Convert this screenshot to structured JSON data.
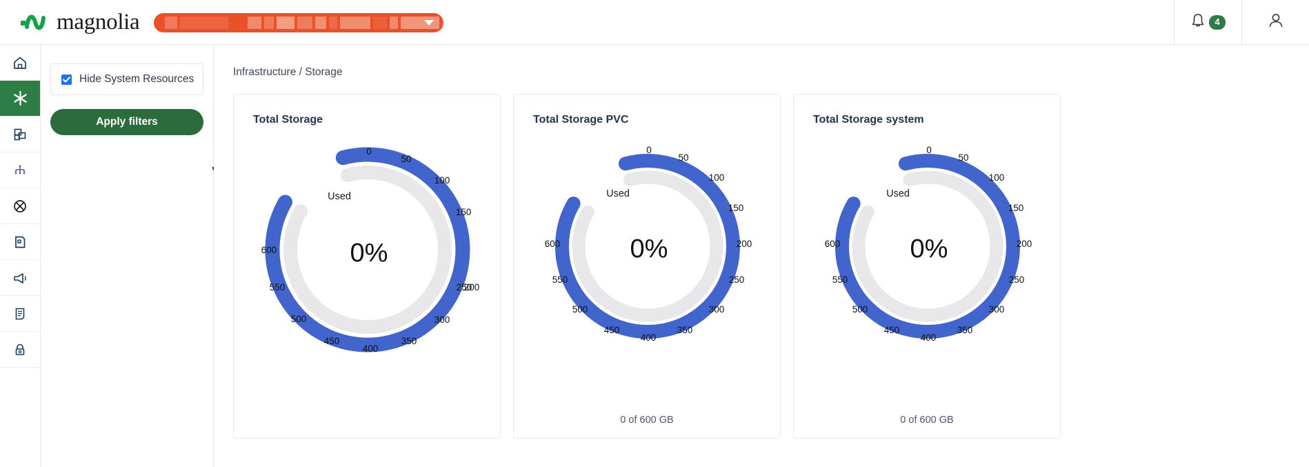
{
  "topbar": {
    "brand_name": "magnolia",
    "brand_icon": "magnolia-wave-logo",
    "selector": {
      "icon": "chevron-down-icon",
      "redacted": true,
      "accent": "#e8512a",
      "block_widths": [
        18,
        70,
        20,
        14,
        26,
        22,
        16,
        12,
        44,
        20,
        12,
        56,
        14
      ]
    },
    "notifications": {
      "icon": "bell-icon",
      "count": "4",
      "badge_color": "#2e7d46"
    },
    "account": {
      "icon": "user-icon"
    }
  },
  "sidebar": {
    "items": [
      {
        "icon": "home-icon",
        "name": "home",
        "active": false
      },
      {
        "icon": "asterisk-icon",
        "name": "infrastructure",
        "active": true
      },
      {
        "icon": "stacked-squares-icon",
        "name": "applications",
        "active": false
      },
      {
        "icon": "hierarchy-icon",
        "name": "topology",
        "active": false
      },
      {
        "icon": "circle-slash-icon",
        "name": "blocked",
        "active": false
      },
      {
        "icon": "page-corner-icon",
        "name": "reports",
        "active": false
      },
      {
        "icon": "megaphone-icon",
        "name": "announcements",
        "active": false
      },
      {
        "icon": "document-lines-icon",
        "name": "logs",
        "active": false
      },
      {
        "icon": "lock-icon",
        "name": "security",
        "active": false
      }
    ]
  },
  "filters": {
    "hide_system_resources": {
      "label": "Hide System Resources",
      "checked": true,
      "color": "#1a73e8"
    },
    "apply_label": "Apply filters",
    "apply_color": "#2b6b3c",
    "cursor": "pointer-hand"
  },
  "main": {
    "breadcrumb": "Infrastructure / Storage"
  },
  "chart_data": [
    {
      "type": "gauge",
      "title": "Total Storage",
      "center_label": "0%",
      "series_label": "Used",
      "footer": "",
      "value": 0,
      "axis_min": 0,
      "axis_max": 600,
      "tick_labels": [
        "0",
        "50",
        "100",
        "150",
        "200",
        "250",
        "300",
        "350",
        "400",
        "450",
        "500",
        "550",
        "600"
      ],
      "track_color": "#e8e8ea",
      "arc_color": "#4264cd",
      "unit": "GB"
    },
    {
      "type": "gauge",
      "title": "Total Storage PVC",
      "center_label": "0%",
      "series_label": "Used",
      "footer": "0 of 600 GB",
      "value": 0,
      "axis_min": 0,
      "axis_max": 600,
      "tick_labels": [
        "0",
        "50",
        "100",
        "150",
        "200",
        "250",
        "300",
        "350",
        "400",
        "450",
        "500",
        "550",
        "600"
      ],
      "track_color": "#e8e8ea",
      "arc_color": "#4264cd",
      "unit": "GB"
    },
    {
      "type": "gauge",
      "title": "Total Storage system",
      "center_label": "0%",
      "series_label": "Used",
      "footer": "0 of 600 GB",
      "value": 0,
      "axis_min": 0,
      "axis_max": 600,
      "tick_labels": [
        "0",
        "50",
        "100",
        "150",
        "200",
        "250",
        "300",
        "350",
        "400",
        "450",
        "500",
        "550",
        "600"
      ],
      "track_color": "#e8e8ea",
      "arc_color": "#4264cd",
      "unit": "GB"
    }
  ]
}
